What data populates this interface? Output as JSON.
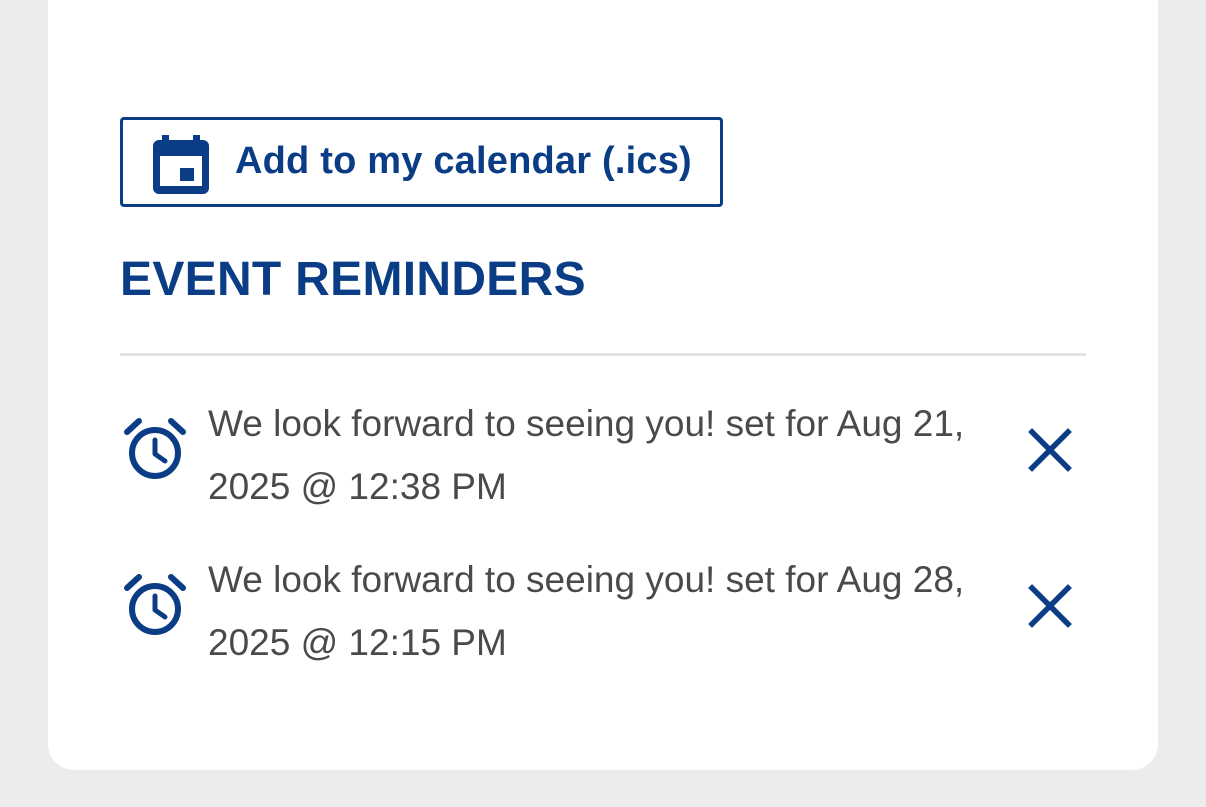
{
  "calendar_button": {
    "label": "Add to my calendar (.ics)",
    "icon": "calendar-icon"
  },
  "reminders_section": {
    "title": "EVENT REMINDERS",
    "items": [
      {
        "text": "We look forward to seeing you! set for Aug 21, 2025 @ 12:38 PM",
        "icon": "alarm-clock-icon",
        "action_icon": "close-icon"
      },
      {
        "text": "We look forward to seeing you! set for Aug 28, 2025 @ 12:15 PM",
        "icon": "alarm-clock-icon",
        "action_icon": "close-icon"
      }
    ]
  },
  "colors": {
    "accent": "#0a3d85",
    "text": "#4a4a4a",
    "page_background": "#ececec",
    "card_background": "#ffffff",
    "divider": "#e3e3e3"
  }
}
